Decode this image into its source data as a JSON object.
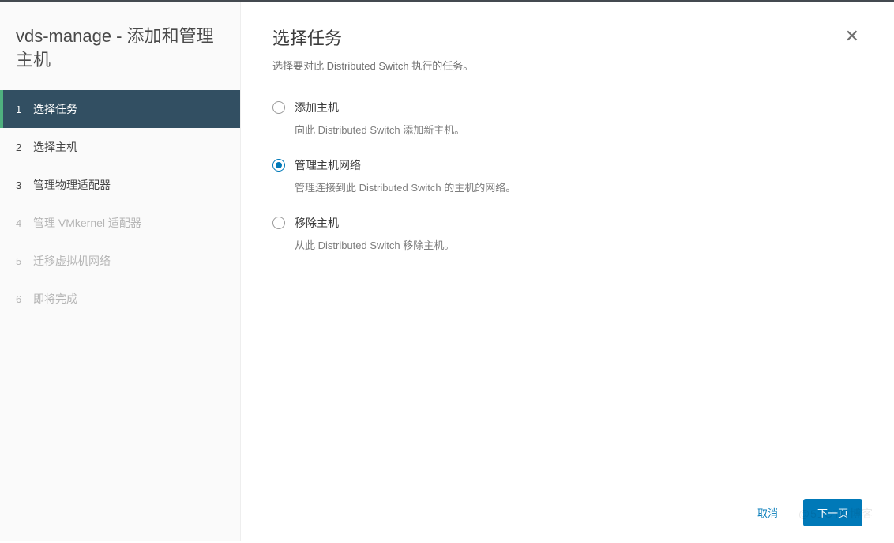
{
  "sidebar": {
    "title": "vds-manage - 添加和管理主机",
    "steps": [
      {
        "num": "1",
        "label": "选择任务",
        "state": "active"
      },
      {
        "num": "2",
        "label": "选择主机",
        "state": "enabled"
      },
      {
        "num": "3",
        "label": "管理物理适配器",
        "state": "enabled"
      },
      {
        "num": "4",
        "label": "管理 VMkernel 适配器",
        "state": "disabled"
      },
      {
        "num": "5",
        "label": "迁移虚拟机网络",
        "state": "disabled"
      },
      {
        "num": "6",
        "label": "即将完成",
        "state": "disabled"
      }
    ]
  },
  "main": {
    "title": "选择任务",
    "subtitle": "选择要对此 Distributed Switch 执行的任务。",
    "options": [
      {
        "id": "add-hosts",
        "label": "添加主机",
        "desc": "向此 Distributed Switch 添加新主机。",
        "selected": false
      },
      {
        "id": "manage-net",
        "label": "管理主机网络",
        "desc": "管理连接到此 Distributed Switch 的主机的网络。",
        "selected": true
      },
      {
        "id": "remove-hosts",
        "label": "移除主机",
        "desc": "从此 Distributed Switch 移除主机。",
        "selected": false
      }
    ]
  },
  "footer": {
    "cancel": "取消",
    "next": "下一页"
  },
  "watermark": "@51CTO博客"
}
